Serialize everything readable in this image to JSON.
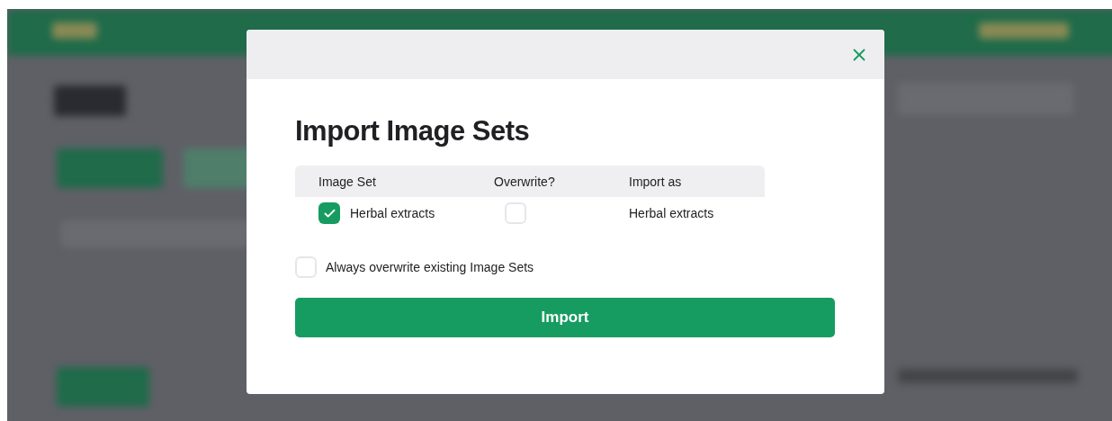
{
  "dialog": {
    "title": "Import Image Sets",
    "table": {
      "columns": [
        "Image Set",
        "Overwrite?",
        "Import as"
      ],
      "rows": [
        {
          "image_set": "Herbal extracts",
          "checked": true,
          "overwrite": false,
          "import_as": "Herbal extracts"
        }
      ]
    },
    "always_overwrite": {
      "label": "Always overwrite existing Image Sets",
      "checked": false
    },
    "button": "Import"
  }
}
